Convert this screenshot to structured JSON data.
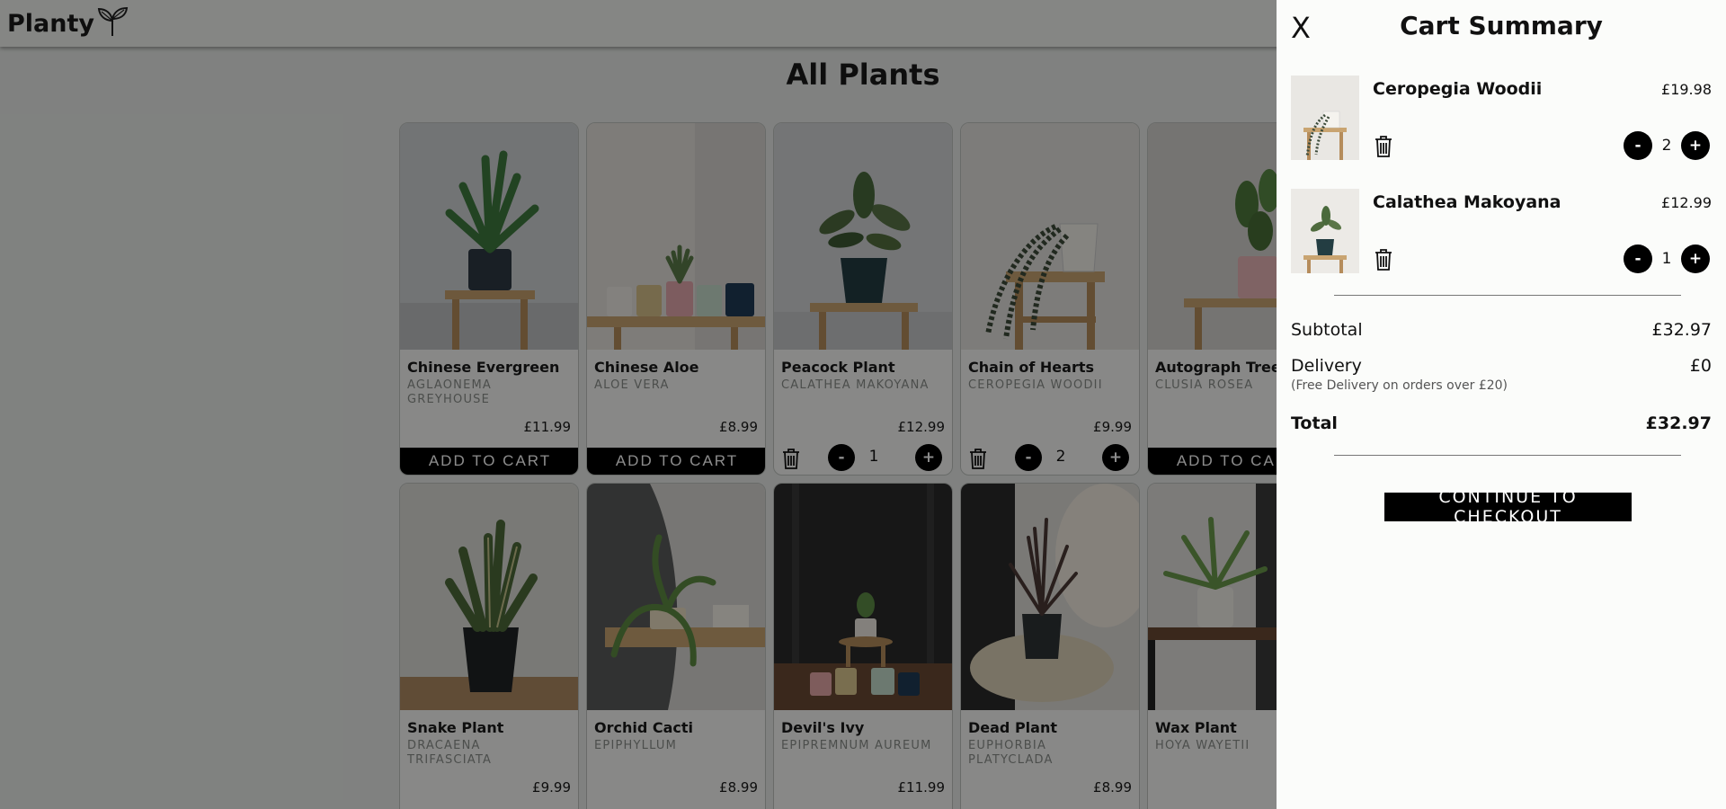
{
  "app": {
    "logo_text": "Planty"
  },
  "page": {
    "title": "All Plants"
  },
  "products": [
    {
      "name": "Chinese Evergreen",
      "latin": "AGLAONEMA GREYHOUSE",
      "price": "£11.99",
      "in_cart": false,
      "button": "ADD TO CART"
    },
    {
      "name": "Chinese Aloe",
      "latin": "ALOE VERA",
      "price": "£8.99",
      "in_cart": false,
      "button": "ADD TO CART"
    },
    {
      "name": "Peacock Plant",
      "latin": "CALATHEA MAKOYANA",
      "price": "£12.99",
      "in_cart": true,
      "qty": "1",
      "minus": "-",
      "plus": "+"
    },
    {
      "name": "Chain of Hearts",
      "latin": "CEROPEGIA WOODII",
      "price": "£9.99",
      "in_cart": true,
      "qty": "2",
      "minus": "-",
      "plus": "+"
    },
    {
      "name": "Autograph Tree",
      "latin": "CLUSIA ROSEA",
      "price": "",
      "in_cart": false,
      "button": "ADD TO CART"
    },
    {
      "name": "Snake Plant",
      "latin": "DRACAENA TRIFASCIATA",
      "price": "£9.99"
    },
    {
      "name": "Orchid Cacti",
      "latin": "EPIPHYLLUM",
      "price": "£8.99"
    },
    {
      "name": "Devil's Ivy",
      "latin": "EPIPREMNUM AUREUM",
      "price": "£11.99"
    },
    {
      "name": "Dead Plant",
      "latin": "EUPHORBIA PLATYCLADA",
      "price": "£8.99"
    },
    {
      "name": "Wax Plant",
      "latin": "HOYA WAYETII",
      "price": ""
    }
  ],
  "cart": {
    "close_label": "X",
    "title": "Cart Summary",
    "items": [
      {
        "name": "Ceropegia Woodii",
        "price": "£19.98",
        "qty": "2",
        "minus": "-",
        "plus": "+"
      },
      {
        "name": "Calathea Makoyana",
        "price": "£12.99",
        "qty": "1",
        "minus": "-",
        "plus": "+"
      }
    ],
    "subtotal_label": "Subtotal",
    "subtotal_value": "£32.97",
    "delivery_label": "Delivery",
    "delivery_value": "£0",
    "delivery_note": "(Free Delivery on orders over £20)",
    "total_label": "Total",
    "total_value": "£32.97",
    "checkout_label": "CONTINUE TO CHECKOUT"
  },
  "icons": {
    "logo": "sprout-icon",
    "remove": "trash-icon",
    "close": "close-icon"
  },
  "colors": {
    "accent": "#000000",
    "panel_bg": "#fbfcfa",
    "overlay": "rgba(0,0,0,0.45)"
  }
}
